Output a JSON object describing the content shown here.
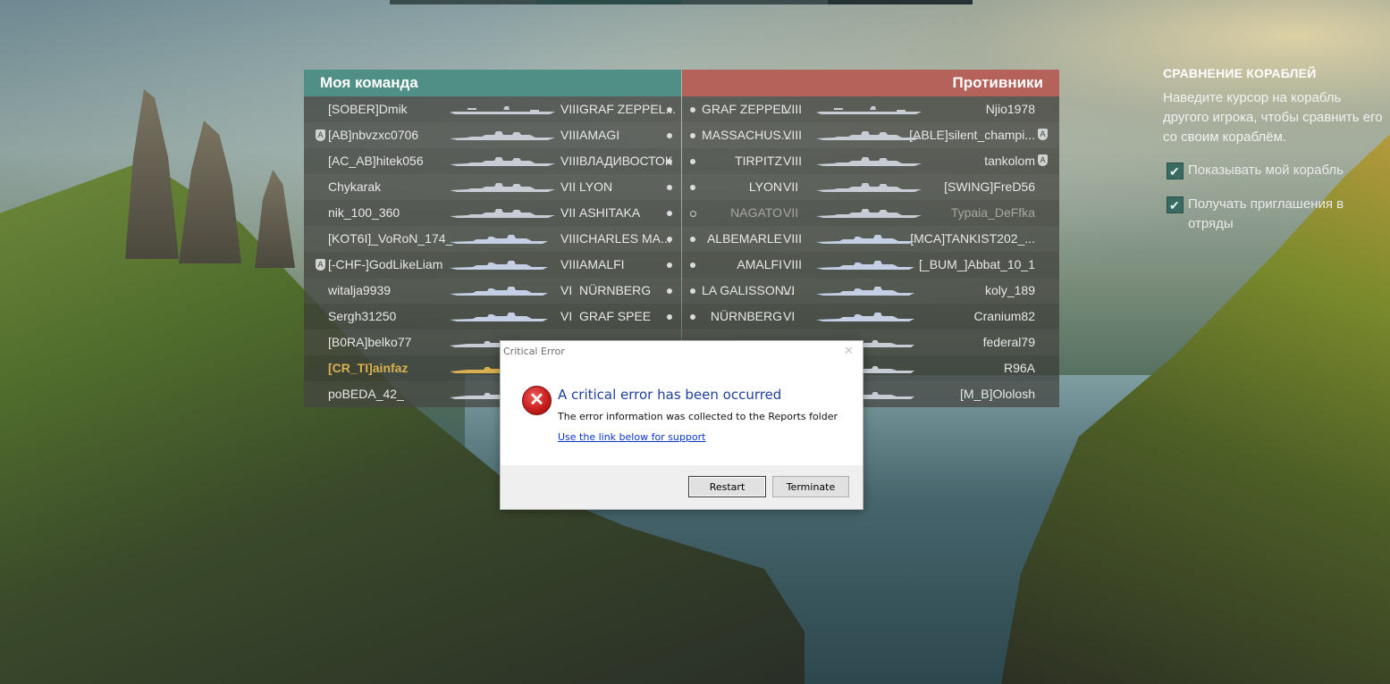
{
  "my_team": {
    "title": "Моя команда",
    "players": [
      {
        "name": "[SOBER]Dmik",
        "tier": "VIII",
        "ship": "GRAF ZEPPEL...",
        "clan_icon": false,
        "class": "carrier"
      },
      {
        "name": "[AB]nbvzxc0706",
        "tier": "VIII",
        "ship": "AMAGI",
        "clan_icon": true,
        "class": "battleship"
      },
      {
        "name": "[AC_AB]hitek056",
        "tier": "VIII",
        "ship": "ВЛАДИВОСТОК",
        "clan_icon": false,
        "class": "battleship"
      },
      {
        "name": "Chykarak",
        "tier": "VII",
        "ship": "LYON",
        "clan_icon": false,
        "class": "battleship"
      },
      {
        "name": "nik_100_360",
        "tier": "VII",
        "ship": "ASHITAKA",
        "clan_icon": false,
        "class": "battleship"
      },
      {
        "name": "[KOT6I]_VoRoN_174_",
        "tier": "VIII",
        "ship": "CHARLES MA...",
        "clan_icon": false,
        "class": "cruiser"
      },
      {
        "name": "[-CHF-]GodLikeLiam",
        "tier": "VIII",
        "ship": "AMALFI",
        "clan_icon": true,
        "class": "cruiser"
      },
      {
        "name": "witalja9939",
        "tier": "VI",
        "ship": "NÜRNBERG",
        "clan_icon": false,
        "class": "cruiser"
      },
      {
        "name": "Sergh31250",
        "tier": "VI",
        "ship": "GRAF SPEE",
        "clan_icon": false,
        "class": "cruiser"
      },
      {
        "name": "[B0RA]belko77",
        "tier": "",
        "ship": "",
        "clan_icon": false,
        "class": "destroyer"
      },
      {
        "name": "[CR_TI]ainfaz",
        "tier": "",
        "ship": "",
        "clan_icon": false,
        "class": "destroyer",
        "highlight": true
      },
      {
        "name": "poBEDA_42_",
        "tier": "",
        "ship": "",
        "clan_icon": false,
        "class": "destroyer"
      }
    ]
  },
  "enemy_team": {
    "title": "Противники",
    "players": [
      {
        "name": "Njio1978",
        "tier": "VIII",
        "ship": "GRAF ZEPPEL...",
        "clan_icon": false,
        "class": "carrier"
      },
      {
        "name": "[ABLE]silent_champi...",
        "tier": "VIII",
        "ship": "MASSACHUS...",
        "clan_icon": true,
        "class": "battleship"
      },
      {
        "name": "tankolom",
        "tier": "VIII",
        "ship": "TIRPITZ",
        "clan_icon": true,
        "class": "battleship"
      },
      {
        "name": "[SWING]FreD56",
        "tier": "VII",
        "ship": "LYON",
        "clan_icon": false,
        "class": "battleship"
      },
      {
        "name": "Typaia_DeFfka",
        "tier": "VII",
        "ship": "NAGATO",
        "clan_icon": false,
        "class": "battleship",
        "dim": true
      },
      {
        "name": "[MCA]TANKIST202_...",
        "tier": "VIII",
        "ship": "ALBEMARLE",
        "clan_icon": false,
        "class": "cruiser"
      },
      {
        "name": "[_BUM_]Abbat_10_1",
        "tier": "VIII",
        "ship": "AMALFI",
        "clan_icon": false,
        "class": "cruiser"
      },
      {
        "name": "koly_189",
        "tier": "VI",
        "ship": "LA GALISSON...",
        "clan_icon": false,
        "class": "cruiser"
      },
      {
        "name": "Cranium82",
        "tier": "VI",
        "ship": "NÜRNBERG",
        "clan_icon": false,
        "class": "cruiser"
      },
      {
        "name": "federal79",
        "tier": "",
        "ship": "",
        "clan_icon": false,
        "class": "destroyer"
      },
      {
        "name": "R96A",
        "tier": "",
        "ship": "",
        "clan_icon": false,
        "class": "destroyer"
      },
      {
        "name": "[M_B]Ololosh",
        "tier": "",
        "ship": "",
        "clan_icon": false,
        "class": "destroyer"
      }
    ]
  },
  "compare": {
    "title": "СРАВНЕНИЕ КОРАБЛЕЙ",
    "description": "Наведите курсор на корабль другого игрока, чтобы сравнить его со своим кораблём.",
    "options": [
      {
        "label": "Показывать мой корабль",
        "checked": true
      },
      {
        "label": "Получать приглашения в отряды",
        "checked": true
      }
    ]
  },
  "dialog": {
    "window_title": "Critical Error",
    "heading": "A critical error has been occurred",
    "message": "The error information was collected to the Reports folder",
    "link": "Use the link below for support",
    "restart_label": "Restart",
    "terminate_label": "Terminate"
  },
  "colors": {
    "my_team_header": "#4f8f86",
    "enemy_team_header": "#b4625a",
    "highlight_player": "#d8b050",
    "ship_silhouette": "#c8ccd4",
    "ship_silhouette_cruiser": "#c4cfe6"
  }
}
